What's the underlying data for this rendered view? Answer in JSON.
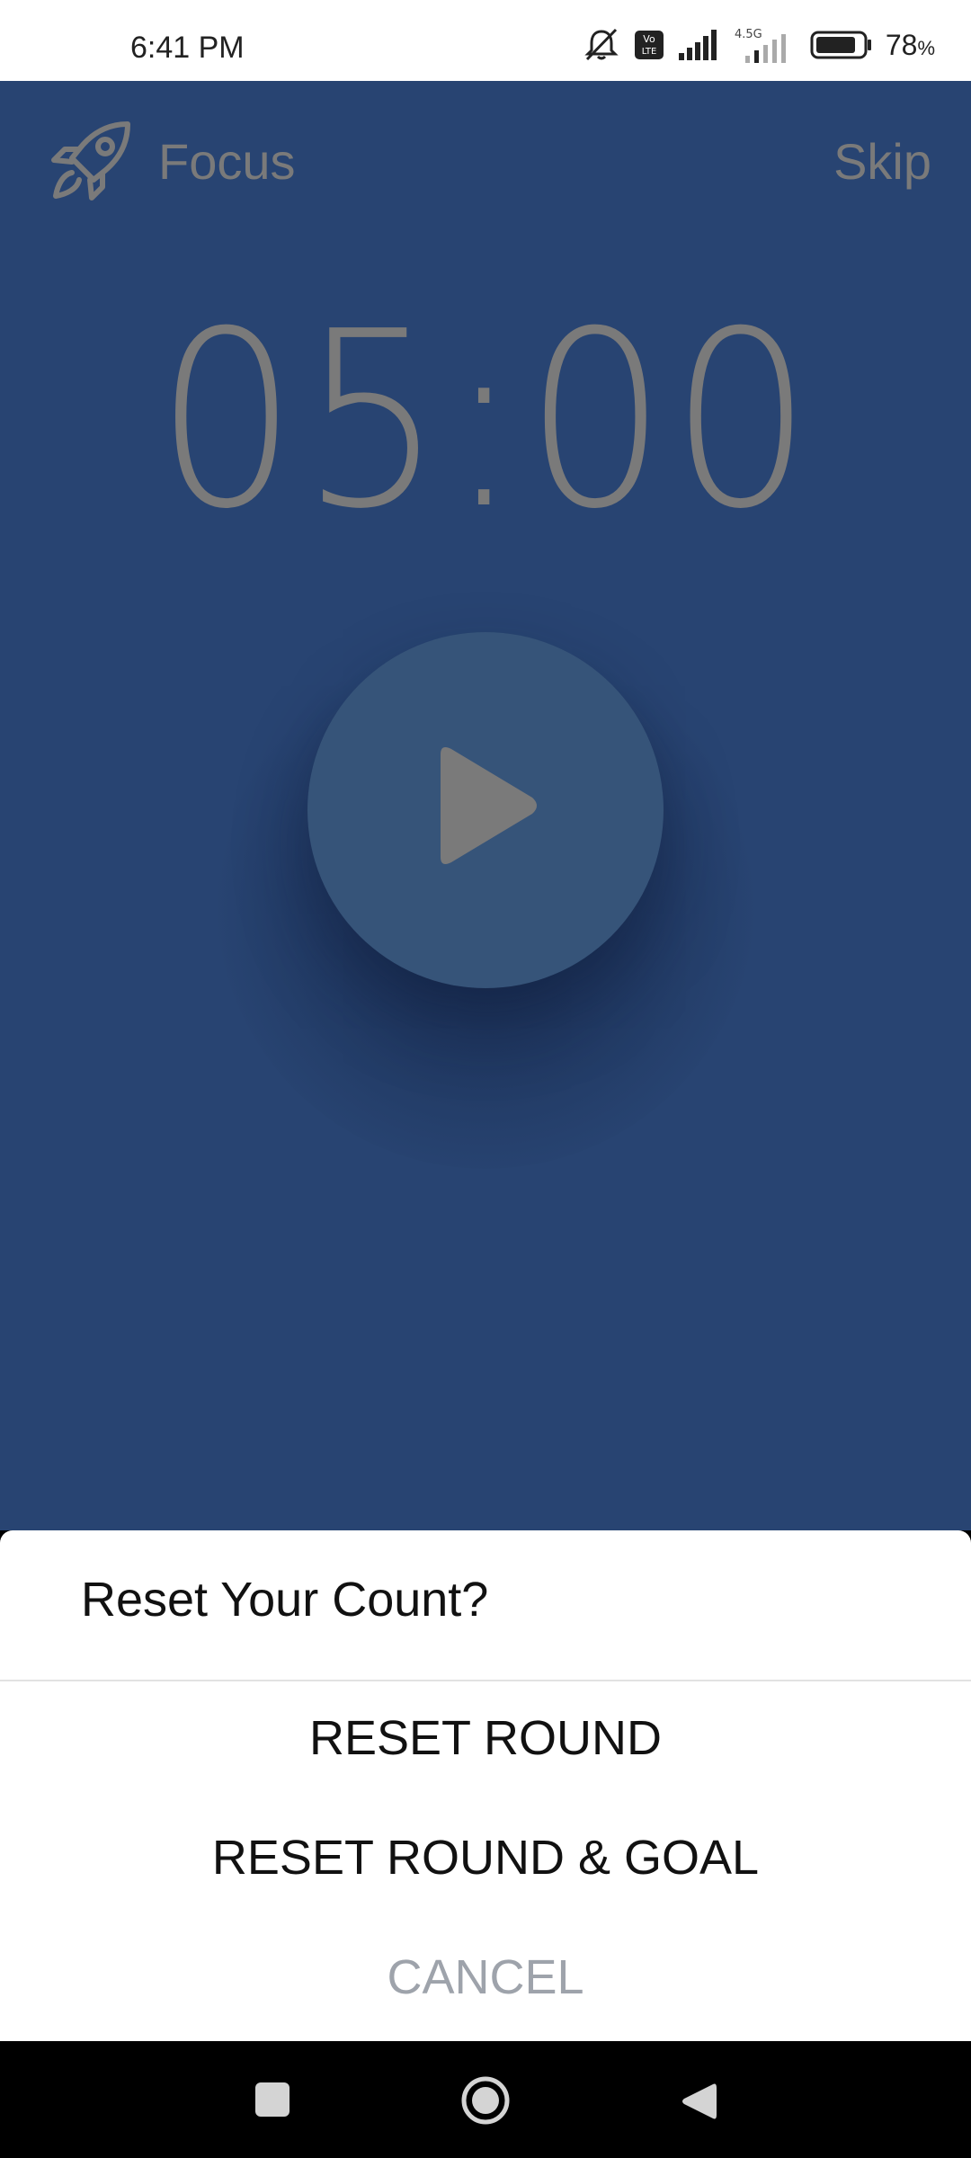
{
  "status_bar": {
    "time": "6:41 PM",
    "network_label": "4.5G",
    "volte_label": "Vo LTE",
    "battery_percent": "78",
    "battery_unit": "%",
    "icons": [
      "mute-bell-icon",
      "volte-icon",
      "signal-icon",
      "signal-4-5g-icon",
      "battery-icon"
    ]
  },
  "header": {
    "title": "Focus",
    "logo_icon": "rocket-icon",
    "skip_label": "Skip"
  },
  "timer": {
    "display": "05:00"
  },
  "play_button": {
    "icon": "play-icon"
  },
  "sheet": {
    "title": "Reset Your Count?",
    "options": [
      {
        "label": "RESET ROUND"
      },
      {
        "label": "RESET ROUND & GOAL"
      },
      {
        "label": "CANCEL"
      }
    ]
  },
  "nav_bar": {
    "icons": [
      "recents-icon",
      "home-icon",
      "back-icon"
    ]
  },
  "colors": {
    "app_background": "#284472",
    "play_circle": "#365479",
    "muted_text": "#7a7a7a",
    "cancel_text": "#9ea3ab"
  }
}
